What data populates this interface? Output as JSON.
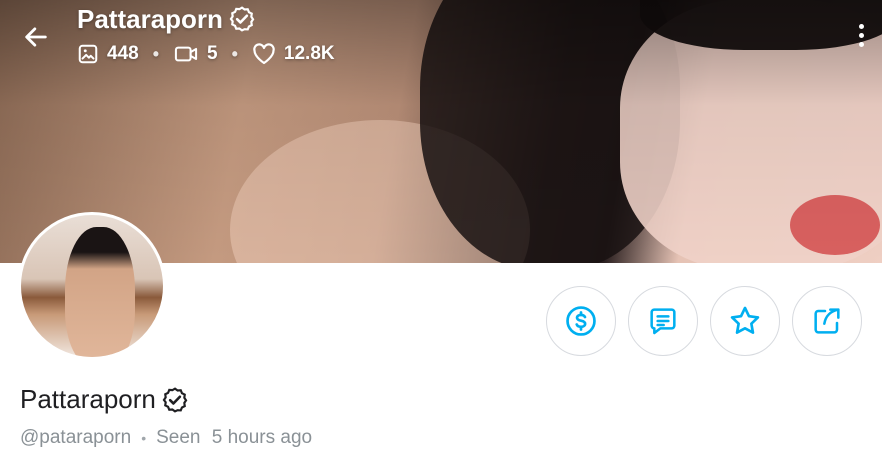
{
  "header": {
    "name": "Pattaraporn",
    "stats": {
      "photos": "448",
      "videos": "5",
      "likes": "12.8K"
    }
  },
  "icons": {
    "back": "arrow-left-icon",
    "verified": "verified-badge-icon",
    "photo": "image-icon",
    "video": "video-camera-icon",
    "like": "heart-icon",
    "more": "vertical-dots-icon",
    "tip": "dollar-circle-icon",
    "message": "message-icon",
    "favorite": "star-icon",
    "share": "share-icon"
  },
  "profile": {
    "display_name": "Pattaraporn",
    "username": "@pataraporn",
    "seen_label": "Seen",
    "seen_time": "5 hours ago"
  },
  "colors": {
    "accent": "#00aff0",
    "text_primary": "#1f1f22",
    "text_muted": "#8a9196",
    "border": "#d7dadf"
  }
}
